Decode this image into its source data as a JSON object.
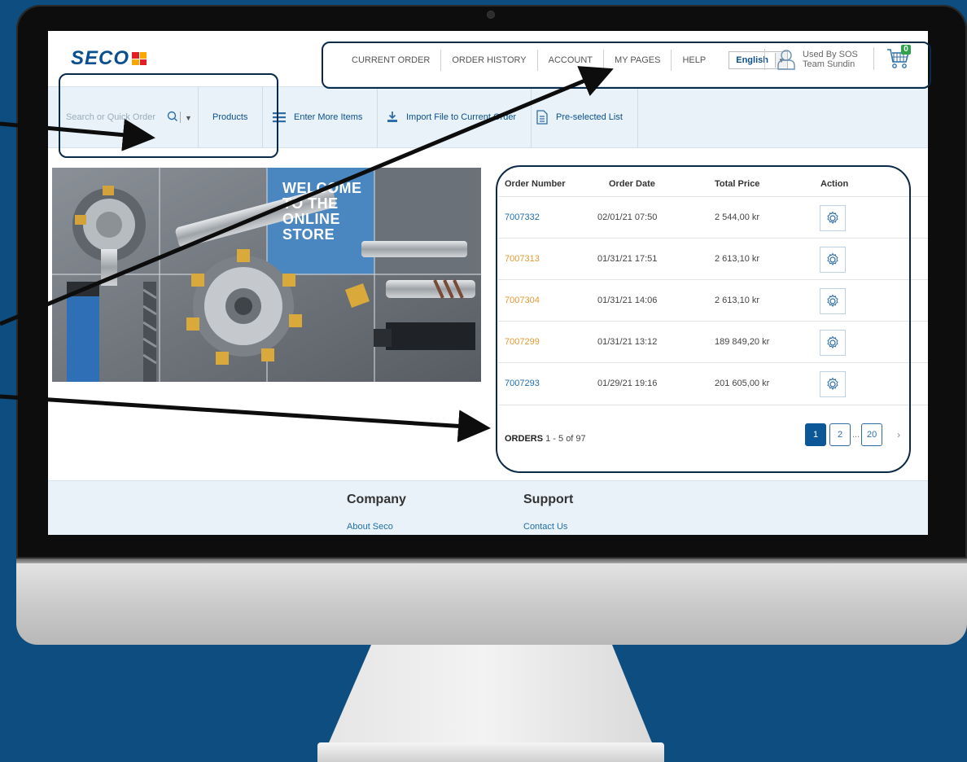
{
  "brand": {
    "logo_text": "SECO"
  },
  "topnav": {
    "items": [
      "CURRENT ORDER",
      "ORDER HISTORY",
      "ACCOUNT",
      "MY PAGES",
      "HELP"
    ],
    "language": "English",
    "user_line1": "Used By SOS",
    "user_line2": "Team Sundin",
    "cart_count": "0"
  },
  "subnav": {
    "search_placeholder": "Search or Quick Order",
    "products": "Products",
    "enter_more": "Enter More Items",
    "import_file": "Import File to Current Order",
    "preselected": "Pre-selected List"
  },
  "banner": {
    "line1": "WELCOME",
    "line2": "TO THE",
    "line3": "ONLINE",
    "line4": "STORE"
  },
  "orders": {
    "headers": {
      "number": "Order Number",
      "date": "Order Date",
      "price": "Total Price",
      "action": "Action"
    },
    "rows": [
      {
        "number": "7007332",
        "date": "02/01/21 07:50",
        "price": "2 544,00 kr"
      },
      {
        "number": "7007313",
        "date": "01/31/21 17:51",
        "price": "2 613,10 kr"
      },
      {
        "number": "7007304",
        "date": "01/31/21 14:06",
        "price": "2 613,10 kr"
      },
      {
        "number": "7007299",
        "date": "01/31/21 13:12",
        "price": "189 849,20 kr"
      },
      {
        "number": "7007293",
        "date": "01/29/21 19:16",
        "price": "201 605,00 kr"
      }
    ],
    "footer_label": "ORDERS",
    "footer_range": "1 - 5 of 97",
    "pager": {
      "p1": "1",
      "p2": "2",
      "dots": "...",
      "last": "20",
      "next": "›"
    }
  },
  "footer": {
    "company": "Company",
    "company_link": "About Seco",
    "support": "Support",
    "support_link": "Contact Us"
  },
  "colors": {
    "brand_blue": "#0b4f8f",
    "order_link": "#1f6ea8",
    "order_link_alt": "#e19a34",
    "background": "#0e4d80"
  }
}
